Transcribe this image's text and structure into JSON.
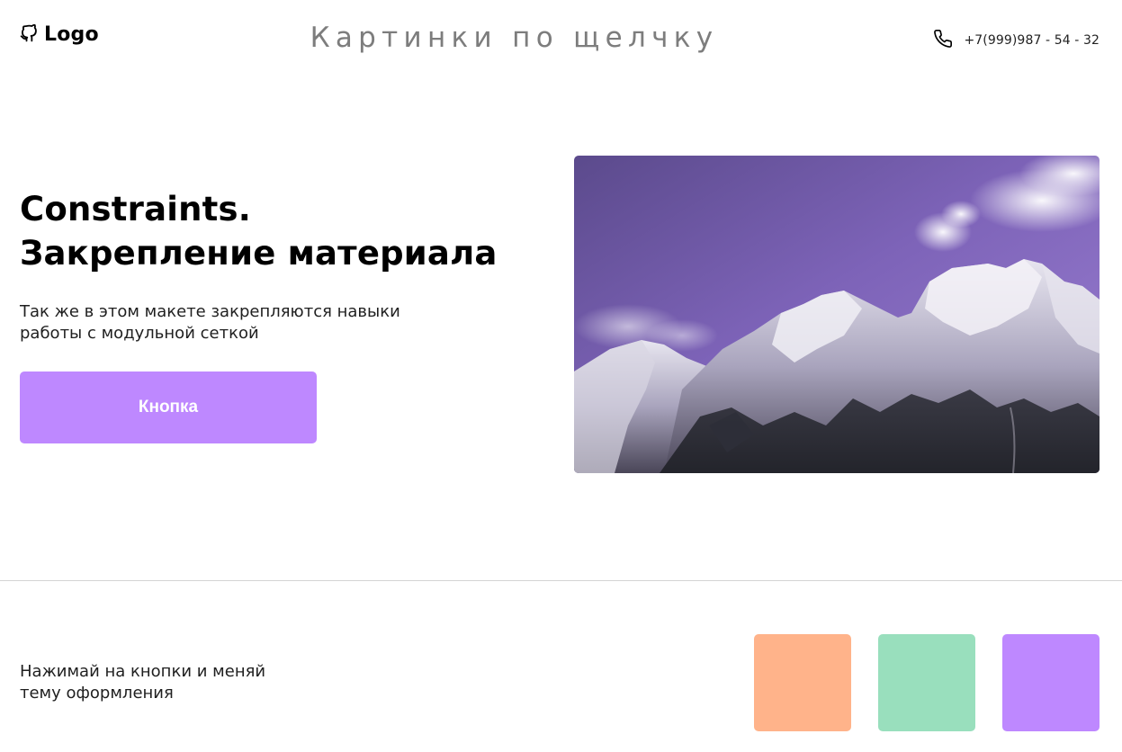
{
  "header": {
    "logo_text": "Logo",
    "logo_icon": "github-cat-icon",
    "title": "Картинки по щелчку",
    "phone_icon": "phone-icon",
    "phone": "+7(999)987 - 54 - 32"
  },
  "hero": {
    "title_line1": "Constraints.",
    "title_line2": "Закрепление материала",
    "description_line1": "Так же в этом макете закрепляются навыки",
    "description_line2": "работы с модульной сеткой",
    "button_label": "Кнопка",
    "button_color": "#be88ff",
    "image_subject": "snowy-mountains-photo"
  },
  "theme": {
    "hint_line1": "Нажимай на кнопки и меняй",
    "hint_line2": "тему оформления",
    "swatches": [
      {
        "name": "orange",
        "color": "#ffb38a"
      },
      {
        "name": "green",
        "color": "#99dfbd"
      },
      {
        "name": "purple",
        "color": "#be88ff"
      }
    ]
  }
}
